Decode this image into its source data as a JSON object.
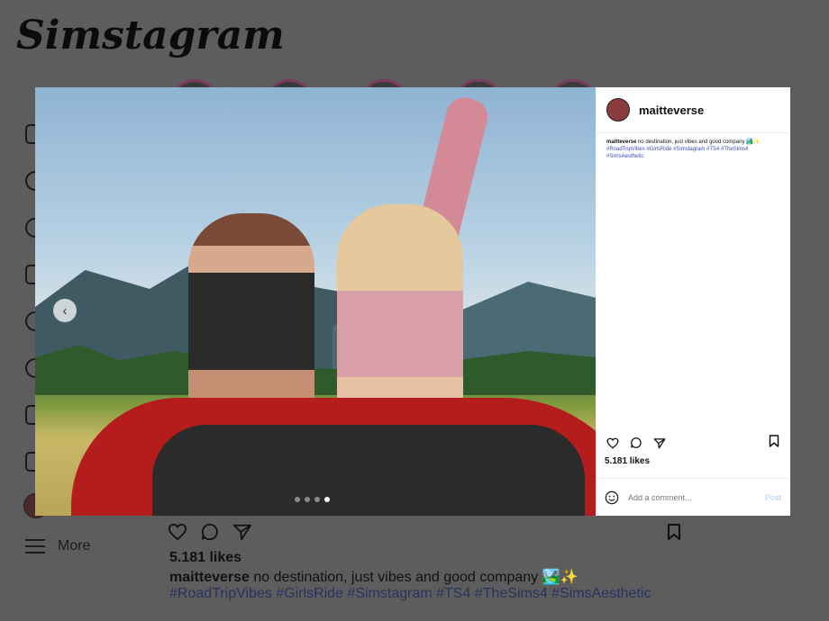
{
  "app": {
    "logo_text": "Simstagram"
  },
  "sidebar": {
    "more_label": "More"
  },
  "post": {
    "username": "maitteverse",
    "caption": "no destination, just vibes and good company 🏞️✨",
    "hashtags": "#RoadTripVibes #GirlsRide #Simstagram #TS4 #TheSims4 #SimsAesthetic",
    "likes": "5.181 likes",
    "comment_placeholder": "Add a comment...",
    "post_button": "Post",
    "carousel": {
      "total": 4,
      "active_index": 4
    }
  },
  "icons": [
    "heart-icon",
    "comment-icon",
    "share-icon",
    "bookmark-icon",
    "emoji-icon",
    "chevron-left-icon",
    "menu-icon"
  ],
  "colors": {
    "overlay": "#5d5d5d",
    "hashtag": "#3b4cb8",
    "post_button": "#b2c6f5",
    "car": "#b51c1c"
  }
}
